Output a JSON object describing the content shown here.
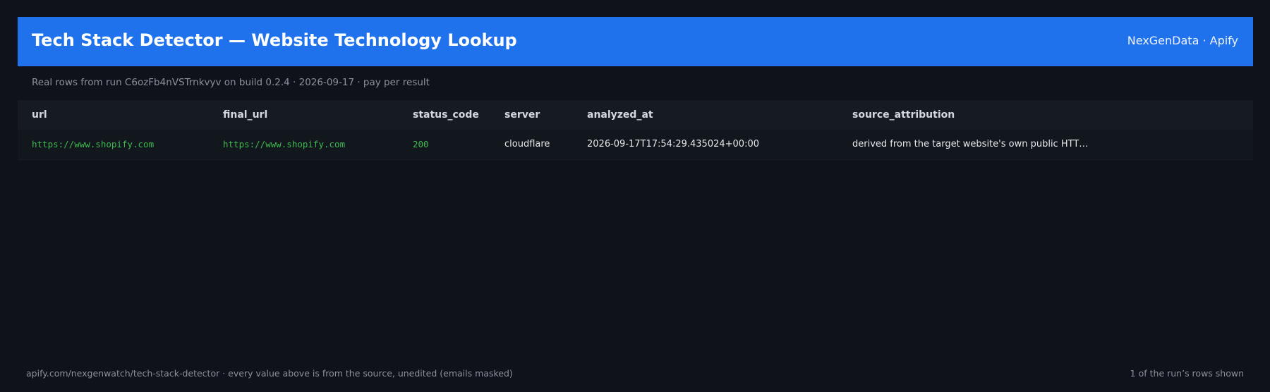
{
  "header": {
    "title": "Tech Stack Detector — Website Technology Lookup",
    "brand": "NexGenData · Apify"
  },
  "subtitle": "Real rows from run C6ozFb4nVSTrnkvyv on build 0.2.4 · 2026-09-17 · pay per result",
  "table": {
    "columns": [
      "url",
      "final_url",
      "status_code",
      "server",
      "analyzed_at",
      "source_attribution"
    ],
    "rows": [
      {
        "url": "https://www.shopify.com",
        "final_url": "https://www.shopify.com",
        "status_code": "200",
        "server": "cloudflare",
        "analyzed_at": "2026-09-17T17:54:29.435024+00:00",
        "source_attribution": "derived from the target website's own public HTT…"
      }
    ]
  },
  "footer": {
    "left": "apify.com/nexgenwatch/tech-stack-detector  ·  every value above is from the source, unedited (emails masked)",
    "right": "1 of the run’s rows shown"
  },
  "colors": {
    "background": "#0f121a",
    "header": "#2072ec",
    "link": "#3fb950",
    "muted": "#8b9099"
  }
}
